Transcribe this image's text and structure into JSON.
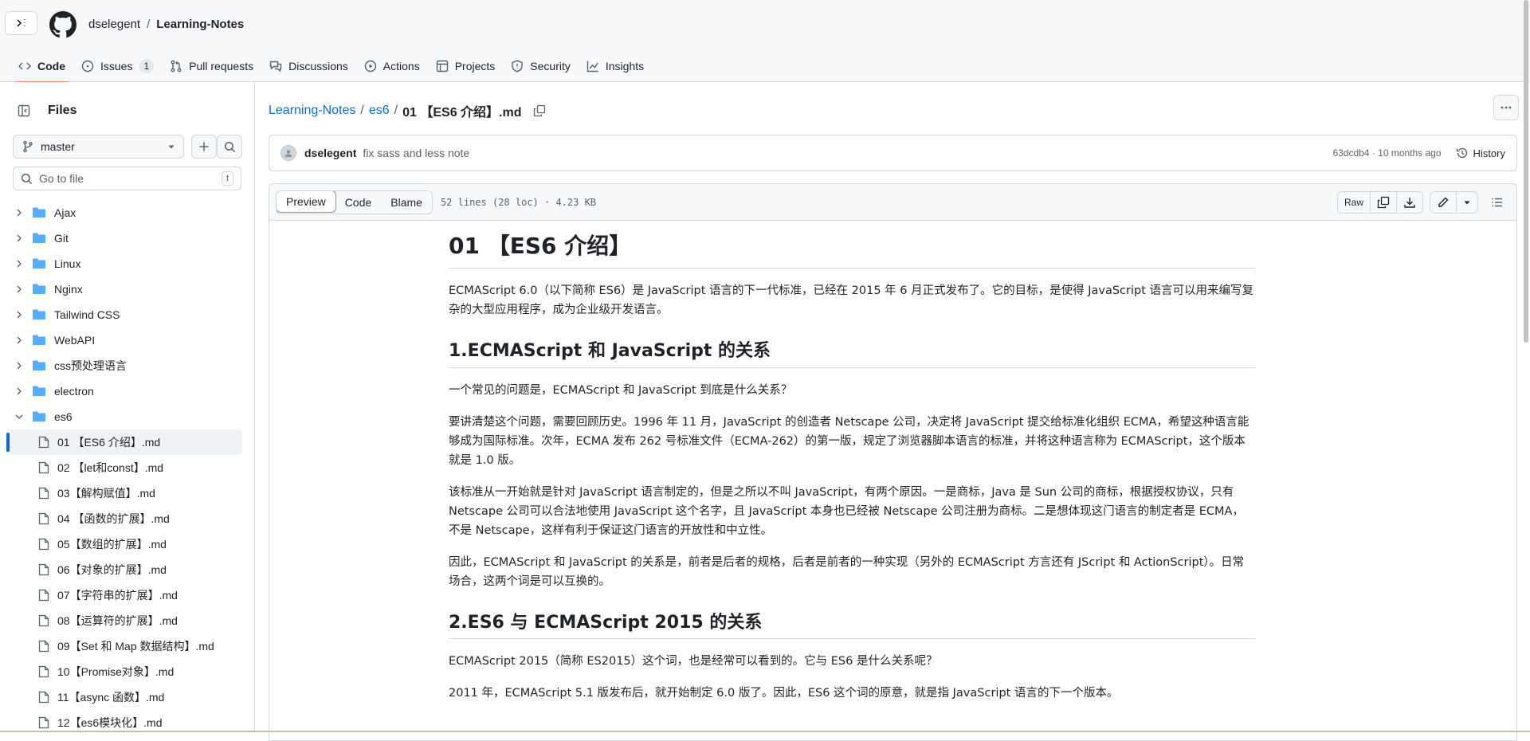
{
  "header": {
    "owner": "dselegent",
    "separator": "/",
    "repo": "Learning-Notes",
    "tabs": [
      {
        "label": "Code",
        "icon": "code-icon"
      },
      {
        "label": "Issues",
        "icon": "issue-icon",
        "count": "1"
      },
      {
        "label": "Pull requests",
        "icon": "pull-request-icon"
      },
      {
        "label": "Discussions",
        "icon": "discussions-icon"
      },
      {
        "label": "Actions",
        "icon": "actions-icon"
      },
      {
        "label": "Projects",
        "icon": "projects-icon"
      },
      {
        "label": "Security",
        "icon": "shield-icon"
      },
      {
        "label": "Insights",
        "icon": "graph-icon"
      }
    ]
  },
  "sidebar": {
    "title": "Files",
    "branch": "master",
    "search_placeholder": "Go to file",
    "search_shortcut": "t",
    "folders": [
      "Ajax",
      "Git",
      "Linux",
      "Nginx",
      "Tailwind CSS",
      "WebAPI",
      "css预处理语言",
      "electron",
      "es6"
    ],
    "files": [
      "01 【ES6 介绍】.md",
      "02 【let和const】.md",
      "03【解构赋值】.md",
      "04 【函数的扩展】.md",
      "05【数组的扩展】.md",
      "06【对象的扩展】.md",
      "07【字符串的扩展】.md",
      "08【运算符的扩展】.md",
      "09【Set 和 Map 数据结构】.md",
      "10【Promise对象】.md",
      "11【async 函数】.md",
      "12【es6模块化】.md"
    ]
  },
  "main": {
    "breadcrumb": {
      "repo": "Learning-Notes",
      "folder": "es6",
      "file": "01 【ES6 介绍】.md",
      "separator": "/"
    },
    "commit": {
      "author": "dselegent",
      "message": "fix sass and less note",
      "meta": "63dcdb4 · 10 months ago",
      "history_label": "History"
    },
    "toolbar": {
      "preview": "Preview",
      "code": "Code",
      "blame": "Blame",
      "info": "52 lines (28 loc) · 4.23 KB",
      "raw": "Raw"
    },
    "content": {
      "h1": "01 【ES6 介绍】",
      "p1": "ECMAScript 6.0（以下简称 ES6）是 JavaScript 语言的下一代标准，已经在 2015 年 6 月正式发布了。它的目标，是使得 JavaScript 语言可以用来编写复杂的大型应用程序，成为企业级开发语言。",
      "h2a": "1.ECMAScript 和 JavaScript 的关系",
      "p2": "一个常见的问题是，ECMAScript 和 JavaScript 到底是什么关系？",
      "p3": "要讲清楚这个问题，需要回顾历史。1996 年 11 月，JavaScript 的创造者 Netscape 公司，决定将 JavaScript 提交给标准化组织 ECMA，希望这种语言能够成为国际标准。次年，ECMA 发布 262 号标准文件（ECMA-262）的第一版，规定了浏览器脚本语言的标准，并将这种语言称为 ECMAScript，这个版本就是 1.0 版。",
      "p4": "该标准从一开始就是针对 JavaScript 语言制定的，但是之所以不叫 JavaScript，有两个原因。一是商标，Java 是 Sun 公司的商标，根据授权协议，只有 Netscape 公司可以合法地使用 JavaScript 这个名字，且 JavaScript 本身也已经被 Netscape 公司注册为商标。二是想体现这门语言的制定者是 ECMA，不是 Netscape，这样有利于保证这门语言的开放性和中立性。",
      "p5": "因此，ECMAScript 和 JavaScript 的关系是，前者是后者的规格，后者是前者的一种实现（另外的 ECMAScript 方言还有 JScript 和 ActionScript）。日常场合，这两个词是可以互换的。",
      "h2b": "2.ES6 与 ECMAScript 2015 的关系",
      "p6": "ECMAScript 2015（简称 ES2015）这个词，也是经常可以看到的。它与 ES6 是什么关系呢？",
      "p7": "2011 年，ECMAScript 5.1 版发布后，就开始制定 6.0 版了。因此，ES6 这个词的原意，就是指 JavaScript 语言的下一个版本。"
    }
  },
  "colors": {
    "link": "#0969da",
    "tab_underline": "#fd8c73",
    "border": "#d1d9e0",
    "folder": "#54aeff"
  }
}
